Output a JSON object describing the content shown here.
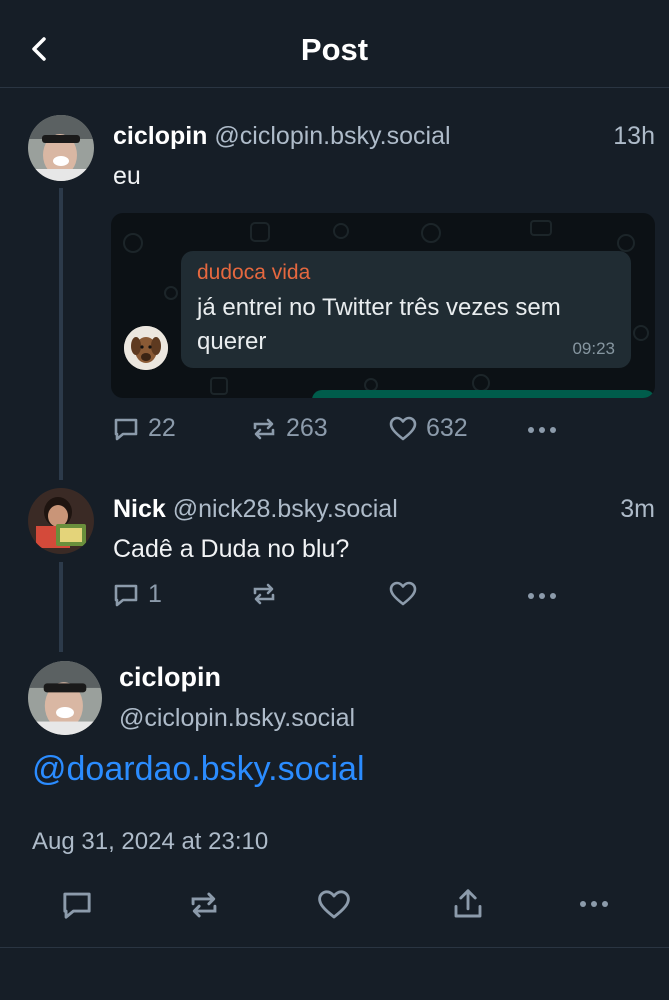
{
  "header": {
    "title": "Post"
  },
  "posts": [
    {
      "name": "ciclopin",
      "handle": "@ciclopin.bsky.social",
      "time": "13h",
      "text": "eu",
      "embed": {
        "sender": "dudoca vida",
        "message": "já entrei no Twitter três vezes sem querer",
        "time": "09:23"
      },
      "stats": {
        "replies": "22",
        "reposts": "263",
        "likes": "632"
      }
    },
    {
      "name": "Nick",
      "handle": "@nick28.bsky.social",
      "time": "3m",
      "text": "Cadê a Duda no blu?",
      "stats": {
        "replies": "1",
        "reposts": "",
        "likes": ""
      }
    }
  ],
  "main_post": {
    "name": "ciclopin",
    "handle": "@ciclopin.bsky.social",
    "mention": "@doardao.bsky.social",
    "date": "Aug 31, 2024 at 23:10"
  },
  "icons": {
    "back": "chevron-left-icon",
    "reply": "speech-bubble-icon",
    "repost": "repost-arrows-icon",
    "like": "heart-icon",
    "share": "share-icon",
    "more": "ellipsis-icon"
  },
  "colors": {
    "background": "#161e27",
    "link": "#2b8cff",
    "muted": "#aebbc9",
    "icon": "#8c9bab",
    "whatsapp_sender": "#e5683f",
    "whatsapp_bubble": "#202c33"
  }
}
